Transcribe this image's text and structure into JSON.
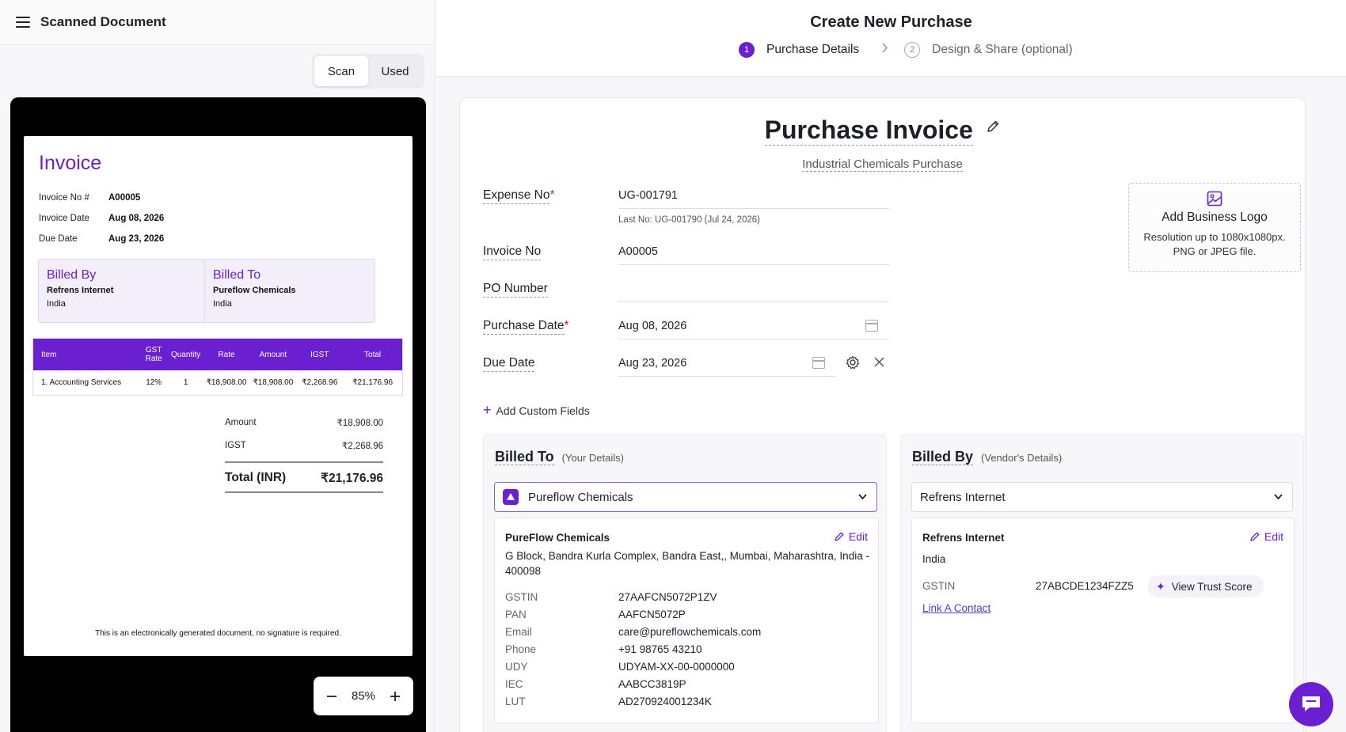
{
  "left": {
    "title": "Scanned Document",
    "tabs": [
      "Scan",
      "Used"
    ],
    "zoom": "85%",
    "invoice": {
      "title": "Invoice",
      "meta": [
        {
          "label": "Invoice No #",
          "value": "A00005"
        },
        {
          "label": "Invoice Date",
          "value": "Aug 08, 2026"
        },
        {
          "label": "Due Date",
          "value": "Aug 23, 2026"
        }
      ],
      "billed_by": {
        "heading": "Billed By",
        "name": "Refrens Internet",
        "country": "India"
      },
      "billed_to": {
        "heading": "Billed To",
        "name": "Pureflow Chemicals",
        "country": "India"
      },
      "columns": [
        "Item",
        "GST Rate",
        "Quantity",
        "Rate",
        "Amount",
        "IGST",
        "Total"
      ],
      "rows": [
        {
          "item": "1.   Accounting Services",
          "gst": "12%",
          "qty": "1",
          "rate": "₹18,908.00",
          "amount": "₹18,908.00",
          "igst": "₹2,268.96",
          "total": "₹21,176.96"
        }
      ],
      "totals": [
        {
          "label": "Amount",
          "value": "₹18,908.00"
        },
        {
          "label": "IGST",
          "value": "₹2,268.96"
        }
      ],
      "grand_label": "Total (INR)",
      "grand_value": "₹21,176.96",
      "footnote": "This is an electronically generated document, no signature is required."
    }
  },
  "header": {
    "title": "Create New Purchase",
    "steps": [
      {
        "num": "1",
        "label": "Purchase Details"
      },
      {
        "num": "2",
        "label": "Design & Share (optional)"
      }
    ]
  },
  "form": {
    "doc_title": "Purchase Invoice",
    "doc_subtitle": "Industrial Chemicals Purchase",
    "expense_label": "Expense No",
    "expense_value": "UG-001791",
    "expense_hint": "Last No: UG-001790 (Jul 24, 2026)",
    "invoice_label": "Invoice No",
    "invoice_value": "A00005",
    "po_label": "PO Number",
    "po_value": "",
    "purchase_date_label": "Purchase Date",
    "purchase_date_value": "Aug 08, 2026",
    "due_date_label": "Due Date",
    "due_date_value": "Aug 23, 2026",
    "add_custom_fields": "Add Custom Fields",
    "logo": {
      "title": "Add Business Logo",
      "desc1": "Resolution up to 1080x1080px.",
      "desc2": "PNG or JPEG file."
    }
  },
  "billed_to": {
    "heading": "Billed To",
    "sub": "(Your Details)",
    "selected": "Pureflow Chemicals",
    "name": "PureFlow Chemicals",
    "edit": "Edit",
    "address": "G Block, Bandra Kurla Complex, Bandra East,, Mumbai, Maharashtra, India - 400098",
    "details": [
      {
        "k": "GSTIN",
        "v": "27AAFCN5072P1ZV"
      },
      {
        "k": "PAN",
        "v": "AAFCN5072P"
      },
      {
        "k": "Email",
        "v": "care@pureflowchemicals.com"
      },
      {
        "k": "Phone",
        "v": "+91 98765 43210"
      },
      {
        "k": "UDY",
        "v": "UDYAM-XX-00-0000000"
      },
      {
        "k": "IEC",
        "v": "AABCC3819P"
      },
      {
        "k": "LUT",
        "v": "AD270924001234K"
      }
    ]
  },
  "billed_by": {
    "heading": "Billed By",
    "sub": "(Vendor's Details)",
    "selected": "Refrens Internet",
    "name": "Refrens Internet",
    "edit": "Edit",
    "country": "India",
    "gstin_label": "GSTIN",
    "gstin_value": "27ABCDE1234FZZ5",
    "trust": "View Trust Score",
    "link": "Link A Contact"
  },
  "colors": {
    "accent": "#6a1fd0",
    "required": "#d0213c",
    "link": "#4a3ce0"
  },
  "icons": [
    "hamburger-icon",
    "pencil-icon",
    "calendar-icon",
    "gear-icon",
    "close-icon",
    "image-icon",
    "plus-icon",
    "chevron-down-icon",
    "chevron-right-icon",
    "sparkle-icon",
    "chat-icon",
    "minus-icon"
  ]
}
